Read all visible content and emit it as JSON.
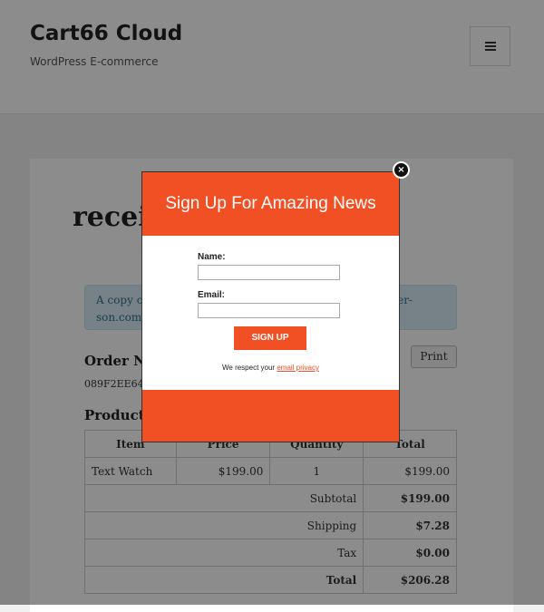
{
  "site": {
    "title": "Cart66 Cloud",
    "description": "WordPress E-commerce"
  },
  "page": {
    "heading": "receipt",
    "notice_line1_start": "A copy of",
    "notice_line1_end": "er-",
    "notice_line2_start": "son.com).",
    "notice_line2_end": "",
    "order_label": "Order Nu",
    "order_id": "089F2EE64",
    "print_label": "Print",
    "products_label": "Products"
  },
  "table": {
    "headers": [
      "Item",
      "Price",
      "Quantity",
      "Total"
    ],
    "rows": [
      {
        "item": "Text Watch",
        "price": "$199.00",
        "quantity": "1",
        "total": "$199.00"
      }
    ],
    "summary": [
      {
        "label": "Subtotal",
        "value": "$199.00"
      },
      {
        "label": "Shipping",
        "value": "$7.28"
      },
      {
        "label": "Tax",
        "value": "$0.00"
      },
      {
        "label": "Total",
        "value": "$206.28"
      }
    ]
  },
  "popup": {
    "title": "Sign Up For Amazing News",
    "name_label": "Name:",
    "name_value": "",
    "email_label": "Email:",
    "email_value": "",
    "button_label": "SIGN UP",
    "privacy_text": "We respect your",
    "privacy_link": "email privacy",
    "close_glyph": "×"
  },
  "colors": {
    "accent": "#f05023",
    "overlay": "rgba(0,0,0,0.45)"
  },
  "icons": {
    "menu": "hamburger-menu-icon",
    "close": "close-icon"
  }
}
